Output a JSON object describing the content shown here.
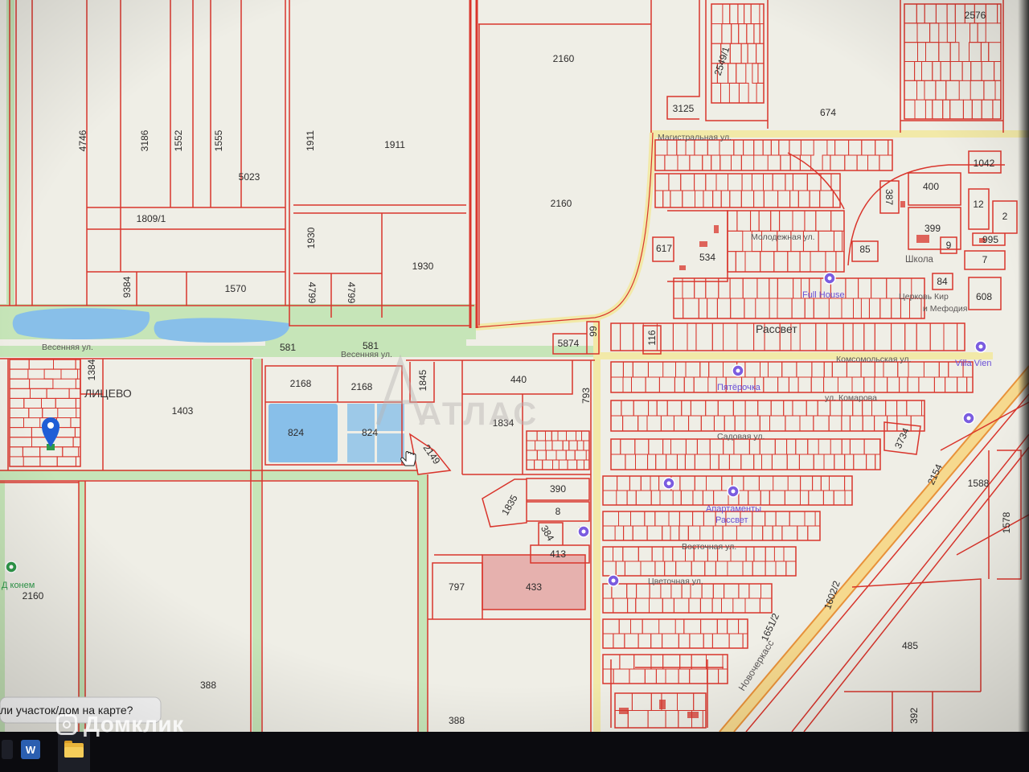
{
  "map": {
    "parcel_labels": [
      "4746",
      "3186",
      "1552",
      "1555",
      "5023",
      "1809/1",
      "9384",
      "1570",
      "1911",
      "1911",
      "1930",
      "1930",
      "4799",
      "4799",
      "2160",
      "2160",
      "3125",
      "2549/1",
      "2576",
      "674",
      "1042",
      "400",
      "387",
      "12",
      "2",
      "399",
      "995",
      "85",
      "9",
      "7",
      "84",
      "608",
      "617",
      "534",
      "116",
      "5874",
      "99",
      "581",
      "581",
      "1384",
      "1403",
      "2168",
      "2168",
      "1845",
      "440",
      "793",
      "824",
      "824",
      "1834",
      "2149",
      "3734",
      "2154",
      "1588",
      "1578",
      "390",
      "1835",
      "8",
      "384",
      "413",
      "797",
      "433",
      "1602/2",
      "1651/2",
      "485",
      "392",
      "388",
      "388",
      "2160"
    ],
    "street_labels": [
      "Весенняя ул.",
      "Весенняя ул.",
      "Магистральная ул.",
      "Молодежная ул.",
      "Комсомольская ул.",
      "ул. Комарова",
      "Садовая ул.",
      "Восточная ул.",
      "Цветочная ул.",
      "Новочеркасс"
    ],
    "poi_labels": [
      "Школа",
      "Церковь Кир",
      "и Мефодия",
      "Full House",
      "Villa Vien",
      "Пятёрочка",
      "Апартаменты",
      "Рассвет",
      "Д конем"
    ],
    "locality_labels": [
      "ЛИЦЕВО",
      "Рассвет"
    ],
    "watermark_atlas": "АТЛАС",
    "tooltip": "ли участок/дом на карте?",
    "colors": {
      "background": "#efeee6",
      "parcel_line": "#d9352c",
      "road_green": "#c6e5b8",
      "water": "#88bfe9",
      "street_yellow": "#f2e9a8",
      "highlight_parcel": "#e6b1ae",
      "poi": "#7a5ce0",
      "pin": "#1f5ed6"
    }
  },
  "watermark_domclick": "Домклик",
  "taskbar": {
    "word_glyph": "W",
    "icons": [
      "start-icon",
      "word-icon",
      "folder-icon"
    ]
  }
}
